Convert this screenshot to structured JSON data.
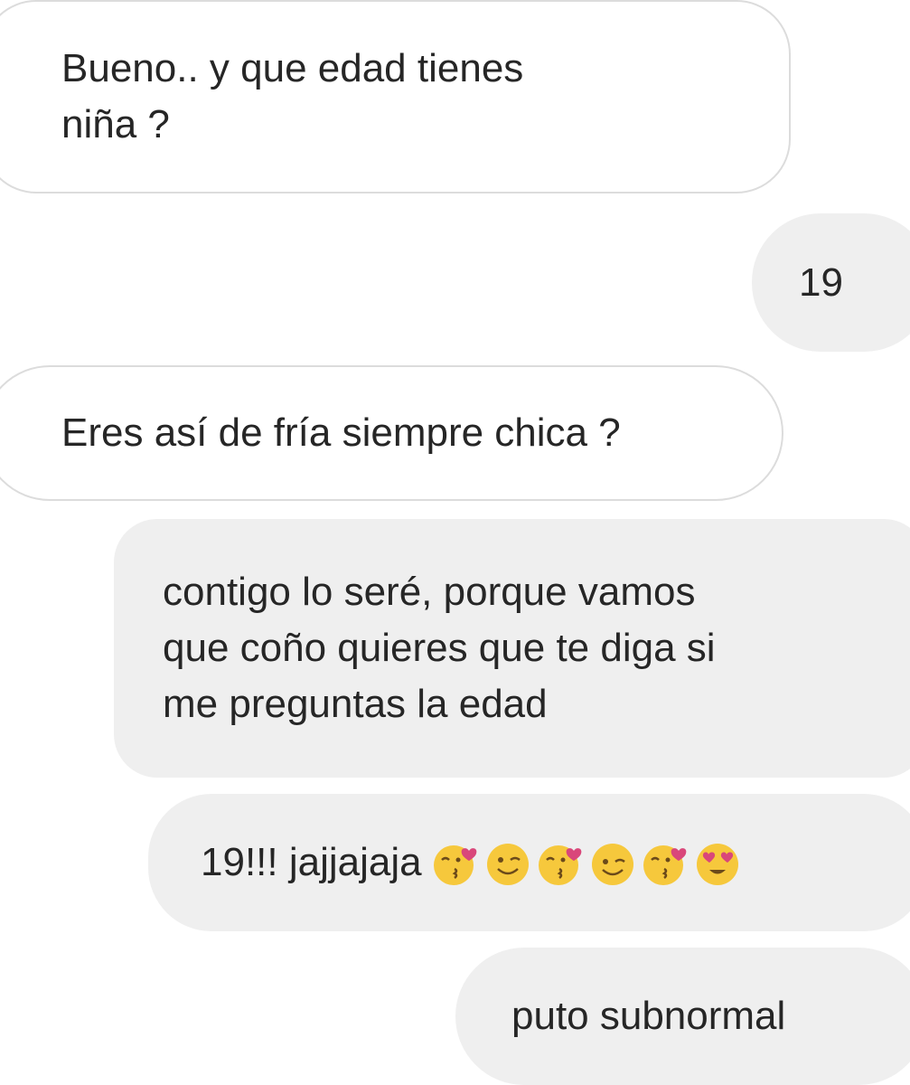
{
  "messages": [
    {
      "side": "received",
      "text": "Bueno.. y que edad tienes\nniña ?"
    },
    {
      "side": "sent",
      "text": "19"
    },
    {
      "side": "received",
      "text": "Eres así de fría siempre chica ?"
    },
    {
      "side": "sent",
      "text": "contigo lo seré, porque vamos\nque coño quieres que te diga si\nme preguntas la edad"
    },
    {
      "side": "sent",
      "text": "19!!! jajjajaja",
      "emojis": [
        "kissing-heart-emoji",
        "winking-emoji",
        "kissing-heart-emoji",
        "winking-emoji",
        "kissing-heart-emoji",
        "heart-eyes-emoji"
      ]
    },
    {
      "side": "sent",
      "text": "puto subnormal"
    }
  ],
  "colors": {
    "sent_bubble": "#efefef",
    "received_bubble": "#ffffff",
    "received_border": "#dcdcdc",
    "text": "#262626",
    "emoji_face": "#f6c83c",
    "emoji_heart": "#d9477a"
  }
}
